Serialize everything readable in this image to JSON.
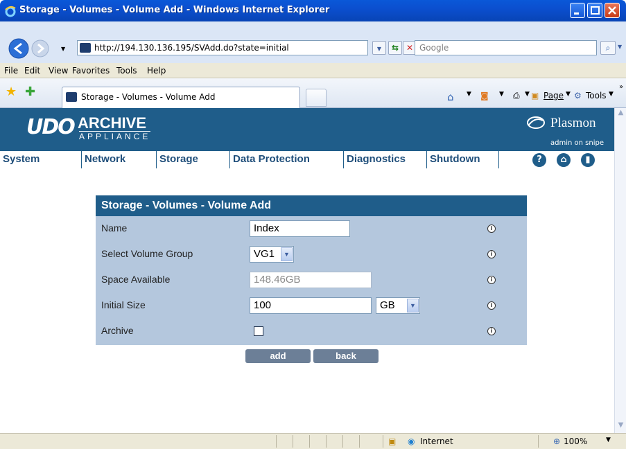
{
  "window": {
    "title": "Storage - Volumes - Volume Add - Windows Internet Explorer"
  },
  "browser": {
    "url": "http://194.130.136.195/SVAdd.do?state=initial",
    "search_placeholder": "Google",
    "menu": [
      "File",
      "Edit",
      "View",
      "Favorites",
      "Tools",
      "Help"
    ],
    "tab_label": "Storage - Volumes - Volume Add",
    "toolbar_right": {
      "page": "Page",
      "tools": "Tools"
    },
    "status": {
      "zone": "Internet",
      "zoom": "100%"
    }
  },
  "header": {
    "logo_udo": "UDO",
    "logo_archive": "ARCHIVE",
    "logo_appliance": "APPLIANCE",
    "brand": "Plasmon",
    "user": "admin on snipe"
  },
  "nav": [
    "System",
    "Network",
    "Storage",
    "Data Protection",
    "Diagnostics",
    "Shutdown"
  ],
  "form": {
    "title": "Storage - Volumes - Volume Add",
    "fields": {
      "name": {
        "label": "Name",
        "value": "Index"
      },
      "volume_group": {
        "label": "Select Volume Group",
        "value": "VG1"
      },
      "space": {
        "label": "Space Available",
        "value": "148.46GB"
      },
      "size": {
        "label": "Initial Size",
        "value": "100",
        "unit": "GB"
      },
      "archive": {
        "label": "Archive",
        "checked": false
      }
    },
    "buttons": {
      "add": "add",
      "back": "back"
    }
  },
  "colors": {
    "header_blue": "#1f5d8a",
    "panel_bg": "#b4c7dd",
    "button": "#6c7f97"
  }
}
